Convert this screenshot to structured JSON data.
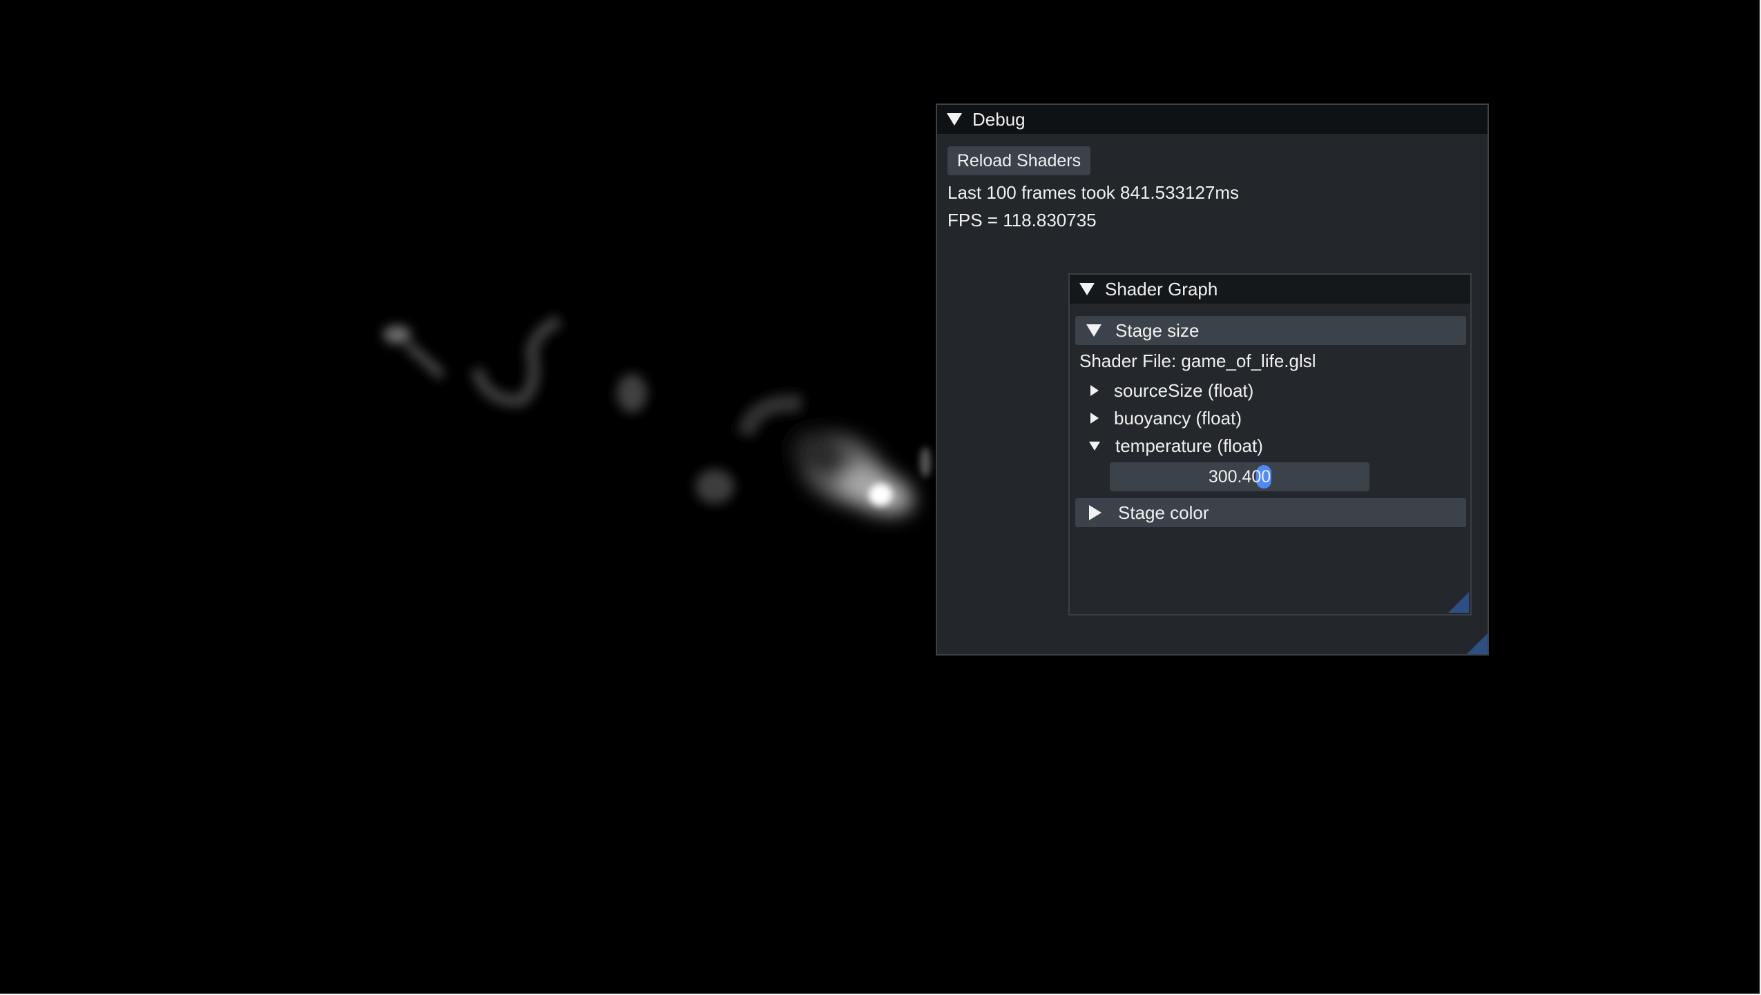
{
  "debug_window": {
    "title": "Debug",
    "reload_button_label": "Reload Shaders",
    "frame_time_text": "Last 100 frames took 841.533127ms",
    "fps_text": "FPS = 118.830735"
  },
  "shader_graph_window": {
    "title": "Shader Graph",
    "stage_size_header": "Stage size",
    "shader_file_text": "Shader File: game_of_life.glsl",
    "uniforms": [
      {
        "label": "sourceSize (float)",
        "expanded": false
      },
      {
        "label": "buoyancy (float)",
        "expanded": false
      },
      {
        "label": "temperature (float)",
        "expanded": true
      }
    ],
    "temperature_value": "300.400",
    "stage_color_header": "Stage color"
  },
  "colors": {
    "viewport_background": "#000000",
    "window_background": "#24282c",
    "title_bar": "#0f1214",
    "frame_background": "#3b4249",
    "accent": "#4d88ff",
    "resize_grip": "#2d4f86"
  }
}
